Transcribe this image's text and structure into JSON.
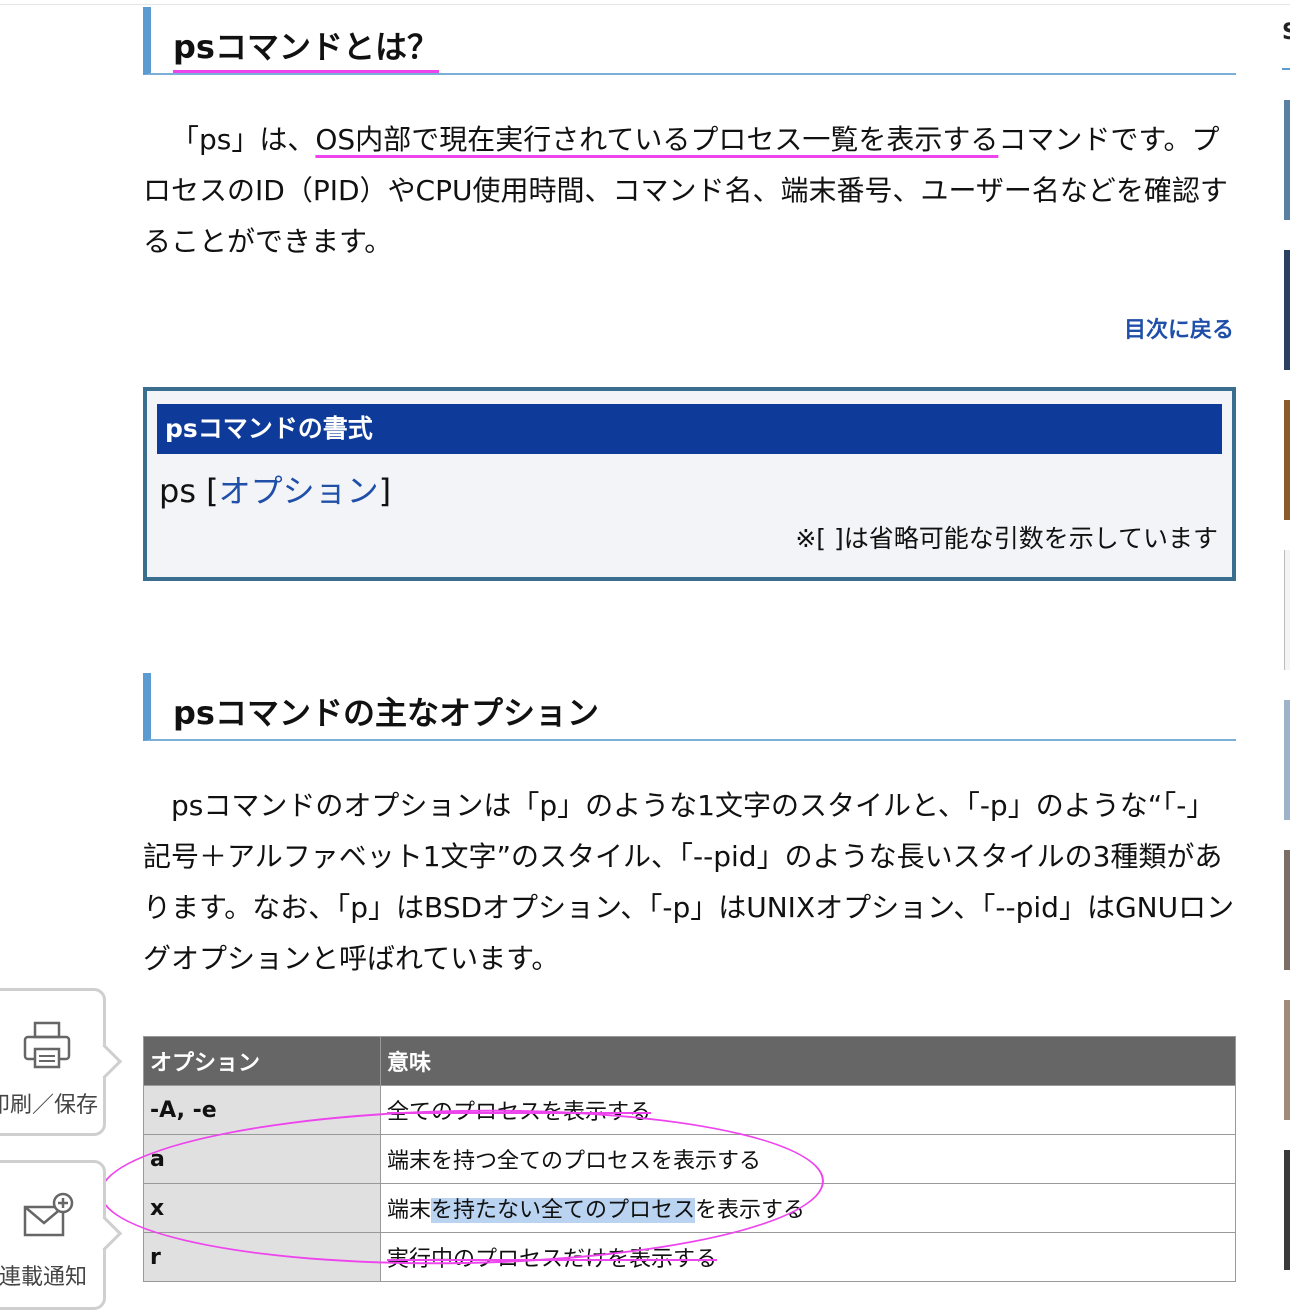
{
  "section1": {
    "heading": "psコマンドとは？",
    "paragraph_lead": "「ps」は、",
    "paragraph_highlight": "OS内部で現在実行されているプロセス一覧を表示する",
    "paragraph_rest": "コマンドです。プロセスのID（PID）やCPU使用時間、コマンド名、端末番号、ユーザー名などを確認することができます。",
    "back_link": "目次に戻る"
  },
  "syntax_box": {
    "title": "psコマンドの書式",
    "command": "ps",
    "open_bracket": "[",
    "option_link": "オプション",
    "close_bracket": "]",
    "note": "※[ ]は省略可能な引数を示しています"
  },
  "section2": {
    "heading": "psコマンドの主なオプション",
    "paragraph": "psコマンドのオプションは「p」のような1文字のスタイルと、「-p」のような“「-」記号＋アルファベット1文字”のスタイル、「--pid」のような長いスタイルの3種類があります。なお、「p」はBSDオプション、「-p」はUNIXオプション、「--pid」はGNUロングオプションと呼ばれています。"
  },
  "options_table": {
    "headers": [
      "オプション",
      "意味"
    ],
    "rows": [
      {
        "option": "-A, -e",
        "meaning": "全てのプロセスを表示する"
      },
      {
        "option": "a",
        "meaning": "端末を持つ全てのプロセスを表示する"
      },
      {
        "option": "x",
        "meaning_pre": "端末",
        "meaning_selected": "を持たない全てのプロセス",
        "meaning_post": "を表示する"
      },
      {
        "option": "r",
        "meaning": "実行中のプロセスだけを表示する"
      }
    ]
  },
  "side_widgets": {
    "print_label": "印刷／保存",
    "notify_label": "連載通知"
  },
  "right_sidebar": {
    "heading_fragment": "S"
  },
  "colors": {
    "heading_accent": "#5c9bd1",
    "annotation_pink": "#ee44ee",
    "syntax_header_bg": "#0e3a9a",
    "link_blue": "#1f4fa8",
    "table_header_bg": "#666666",
    "selection_bg": "#b9d3f0"
  }
}
